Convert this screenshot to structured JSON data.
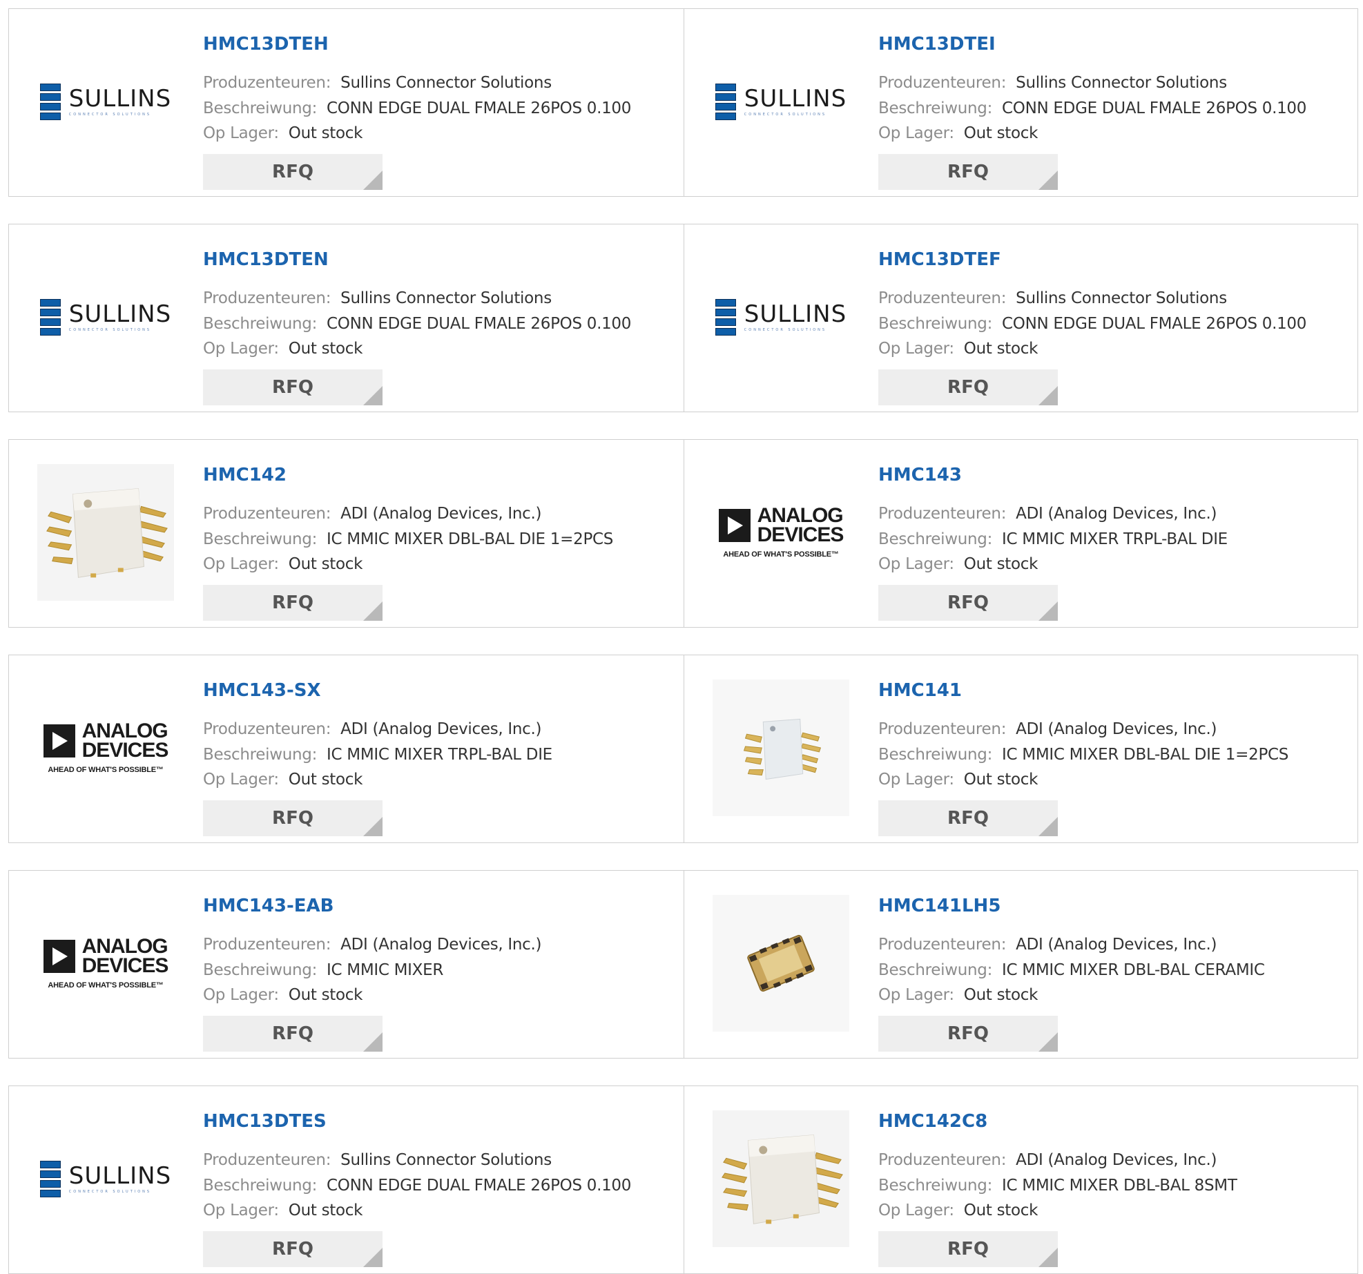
{
  "labels": {
    "manufacturer": "Produzenteuren:",
    "description": "Beschreiwung:",
    "stock": "Op Lager:",
    "rfq": "RFQ"
  },
  "logos": {
    "sullins_name": "SULLINS",
    "sullins_sub": "CONNECTOR SOLUTIONS",
    "adi_line1": "ANALOG",
    "adi_line2": "DEVICES",
    "adi_tagline": "AHEAD OF WHAT'S POSSIBLE™"
  },
  "colors": {
    "part_link": "#1c64ae",
    "label_gray": "#8c8c8c",
    "rfq_bg": "#eeeeee"
  },
  "products": [
    {
      "part": "HMC13DTEH",
      "image": "sullins-logo",
      "manufacturer": "Sullins Connector Solutions",
      "description": "CONN EDGE DUAL FMALE 26POS 0.100",
      "stock": "Out stock"
    },
    {
      "part": "HMC13DTEI",
      "image": "sullins-logo",
      "manufacturer": "Sullins Connector Solutions",
      "description": "CONN EDGE DUAL FMALE 26POS 0.100",
      "stock": "Out stock"
    },
    {
      "part": "HMC13DTEN",
      "image": "sullins-logo",
      "manufacturer": "Sullins Connector Solutions",
      "description": "CONN EDGE DUAL FMALE 26POS 0.100",
      "stock": "Out stock"
    },
    {
      "part": "HMC13DTEF",
      "image": "sullins-logo",
      "manufacturer": "Sullins Connector Solutions",
      "description": "CONN EDGE DUAL FMALE 26POS 0.100",
      "stock": "Out stock"
    },
    {
      "part": "HMC142",
      "image": "chip-8pin-photo",
      "manufacturer": "ADI (Analog Devices, Inc.)",
      "description": "IC MMIC MIXER DBL-BAL DIE 1=2PCS",
      "stock": "Out stock"
    },
    {
      "part": "HMC143",
      "image": "analog-devices-logo",
      "manufacturer": "ADI (Analog Devices, Inc.)",
      "description": "IC MMIC MIXER TRPL-BAL DIE",
      "stock": "Out stock"
    },
    {
      "part": "HMC143-SX",
      "image": "analog-devices-logo",
      "manufacturer": "ADI (Analog Devices, Inc.)",
      "description": "IC MMIC MIXER TRPL-BAL DIE",
      "stock": "Out stock"
    },
    {
      "part": "HMC141",
      "image": "chip-8pin-small-photo",
      "manufacturer": "ADI (Analog Devices, Inc.)",
      "description": "IC MMIC MIXER DBL-BAL DIE 1=2PCS",
      "stock": "Out stock"
    },
    {
      "part": "HMC143-EAB",
      "image": "analog-devices-logo",
      "manufacturer": "ADI (Analog Devices, Inc.)",
      "description": "IC MMIC MIXER",
      "stock": "Out stock"
    },
    {
      "part": "HMC141LH5",
      "image": "chip-ceramic-photo",
      "manufacturer": "ADI (Analog Devices, Inc.)",
      "description": "IC MMIC MIXER DBL-BAL CERAMIC",
      "stock": "Out stock"
    },
    {
      "part": "HMC13DTES",
      "image": "sullins-logo",
      "manufacturer": "Sullins Connector Solutions",
      "description": "CONN EDGE DUAL FMALE 26POS 0.100",
      "stock": "Out stock"
    },
    {
      "part": "HMC142C8",
      "image": "chip-8pin-photo",
      "manufacturer": "ADI (Analog Devices, Inc.)",
      "description": "IC MMIC MIXER DBL-BAL 8SMT",
      "stock": "Out stock"
    }
  ]
}
